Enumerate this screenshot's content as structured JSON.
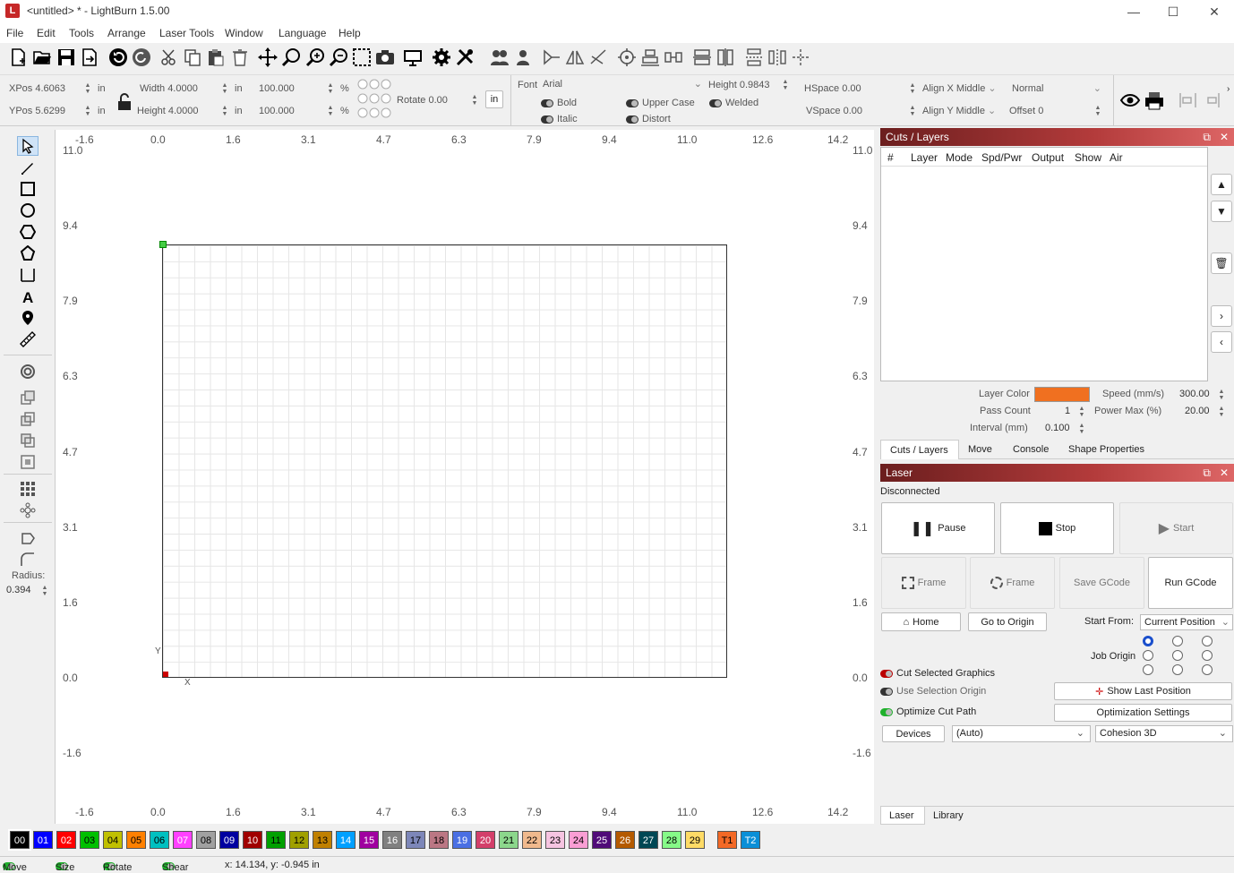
{
  "window": {
    "title": "<untitled> * - LightBurn 1.5.00",
    "minimize": "—",
    "maximize": "☐",
    "close": "✕"
  },
  "menu": [
    "File",
    "Edit",
    "Tools",
    "Arrange",
    "Laser Tools",
    "Window",
    "Language",
    "Help"
  ],
  "options": {
    "xpos_label": "XPos",
    "xpos": "4.6063",
    "ypos_label": "YPos",
    "ypos": "5.6299",
    "unit": "in",
    "width_label": "Width",
    "width": "4.0000",
    "height_label": "Height",
    "height": "4.0000",
    "scale_x": "100.000",
    "scale_y": "100.000",
    "pct": "%",
    "rotate_label": "Rotate",
    "rotate": "0.00",
    "in_button": "in",
    "font_label": "Font",
    "font": "Arial",
    "text_height_label": "Height",
    "text_height": "0.9843",
    "bold": "Bold",
    "italic": "Italic",
    "upper_case": "Upper Case",
    "distort": "Distort",
    "welded": "Welded",
    "hspace_label": "HSpace",
    "hspace": "0.00",
    "vspace_label": "VSpace",
    "vspace": "0.00",
    "alignx_label": "Align X",
    "alignx": "Middle",
    "aligny_label": "Align Y",
    "aligny": "Middle",
    "normal": "Normal",
    "offset_label": "Offset",
    "offset": "0"
  },
  "ruler": {
    "x": [
      "-1.6",
      "0.0",
      "1.6",
      "3.1",
      "4.7",
      "6.3",
      "7.9",
      "9.4",
      "11.0",
      "12.6",
      "14.2"
    ],
    "y": [
      "11.0",
      "9.4",
      "7.9",
      "6.3",
      "4.7",
      "3.1",
      "1.6",
      "0.0",
      "-1.6"
    ],
    "x_axis": "X",
    "y_axis": "Y"
  },
  "lefttools": {
    "radius_label": "Radius:",
    "radius": "0.394"
  },
  "cuts": {
    "title": "Cuts / Layers",
    "columns": [
      "#",
      "Layer",
      "Mode",
      "Spd/Pwr",
      "Output",
      "Show",
      "Air"
    ],
    "layer_color_label": "Layer Color",
    "layer_color": "#f07020",
    "speed_label": "Speed (mm/s)",
    "speed": "300.00",
    "pass_count_label": "Pass Count",
    "pass_count": "1",
    "power_label": "Power Max (%)",
    "power": "20.00",
    "interval_label": "Interval (mm)",
    "interval": "0.100",
    "tabs": [
      "Cuts / Layers",
      "Move",
      "Console",
      "Shape Properties"
    ]
  },
  "laser": {
    "title": "Laser",
    "status": "Disconnected",
    "pause": "Pause",
    "stop": "Stop",
    "start": "Start",
    "frame1": "Frame",
    "frame2": "Frame",
    "save_gcode": "Save GCode",
    "run_gcode": "Run GCode",
    "home": "Home",
    "go_to_origin": "Go to Origin",
    "start_from_label": "Start From:",
    "start_from": "Current Position",
    "job_origin_label": "Job Origin",
    "cut_selected": "Cut Selected Graphics",
    "use_selection_origin": "Use Selection Origin",
    "optimize_cut_path": "Optimize Cut Path",
    "show_last_position": "Show Last Position",
    "optimization_settings": "Optimization Settings",
    "devices": "Devices",
    "device": "(Auto)",
    "profile": "Cohesion 3D",
    "tabs": [
      "Laser",
      "Library"
    ]
  },
  "swatches": [
    {
      "l": "00",
      "c": "#000000",
      "t": "#ffffff"
    },
    {
      "l": "01",
      "c": "#0000ff",
      "t": "#ffffff"
    },
    {
      "l": "02",
      "c": "#ff0000",
      "t": "#ffffff"
    },
    {
      "l": "03",
      "c": "#00c000",
      "t": "#000000"
    },
    {
      "l": "04",
      "c": "#c0c000",
      "t": "#000000"
    },
    {
      "l": "05",
      "c": "#ff8000",
      "t": "#000000"
    },
    {
      "l": "06",
      "c": "#00c0c0",
      "t": "#000000"
    },
    {
      "l": "07",
      "c": "#ff40ff",
      "t": "#ffffff"
    },
    {
      "l": "08",
      "c": "#a0a0a0",
      "t": "#000000"
    },
    {
      "l": "09",
      "c": "#0000a0",
      "t": "#ffffff"
    },
    {
      "l": "10",
      "c": "#a00000",
      "t": "#ffffff"
    },
    {
      "l": "11",
      "c": "#00a000",
      "t": "#000000"
    },
    {
      "l": "12",
      "c": "#a0a000",
      "t": "#000000"
    },
    {
      "l": "13",
      "c": "#c08000",
      "t": "#000000"
    },
    {
      "l": "14",
      "c": "#00a0ff",
      "t": "#ffffff"
    },
    {
      "l": "15",
      "c": "#a000a0",
      "t": "#ffffff"
    },
    {
      "l": "16",
      "c": "#808080",
      "t": "#ffffff"
    },
    {
      "l": "17",
      "c": "#7d87b9",
      "t": "#000000"
    },
    {
      "l": "18",
      "c": "#bb7784",
      "t": "#000000"
    },
    {
      "l": "19",
      "c": "#4a6fe3",
      "t": "#ffffff"
    },
    {
      "l": "20",
      "c": "#d33f6a",
      "t": "#ffffff"
    },
    {
      "l": "21",
      "c": "#8cd78c",
      "t": "#000000"
    },
    {
      "l": "22",
      "c": "#f0b98d",
      "t": "#000000"
    },
    {
      "l": "23",
      "c": "#f6c4e1",
      "t": "#000000"
    },
    {
      "l": "24",
      "c": "#fa9ed4",
      "t": "#000000"
    },
    {
      "l": "25",
      "c": "#500a78",
      "t": "#ffffff"
    },
    {
      "l": "26",
      "c": "#b45a00",
      "t": "#ffffff"
    },
    {
      "l": "27",
      "c": "#004754",
      "t": "#ffffff"
    },
    {
      "l": "28",
      "c": "#86fa88",
      "t": "#000000"
    },
    {
      "l": "29",
      "c": "#ffdb66",
      "t": "#000000"
    },
    {
      "l": "T1",
      "c": "#f36926",
      "t": "#000000"
    },
    {
      "l": "T2",
      "c": "#0a8fd7",
      "t": "#ffffff"
    }
  ],
  "status": {
    "move": "Move",
    "size": "Size",
    "rotate": "Rotate",
    "shear": "Shear",
    "coords": "x: 14.134, y: -0.945 in"
  }
}
